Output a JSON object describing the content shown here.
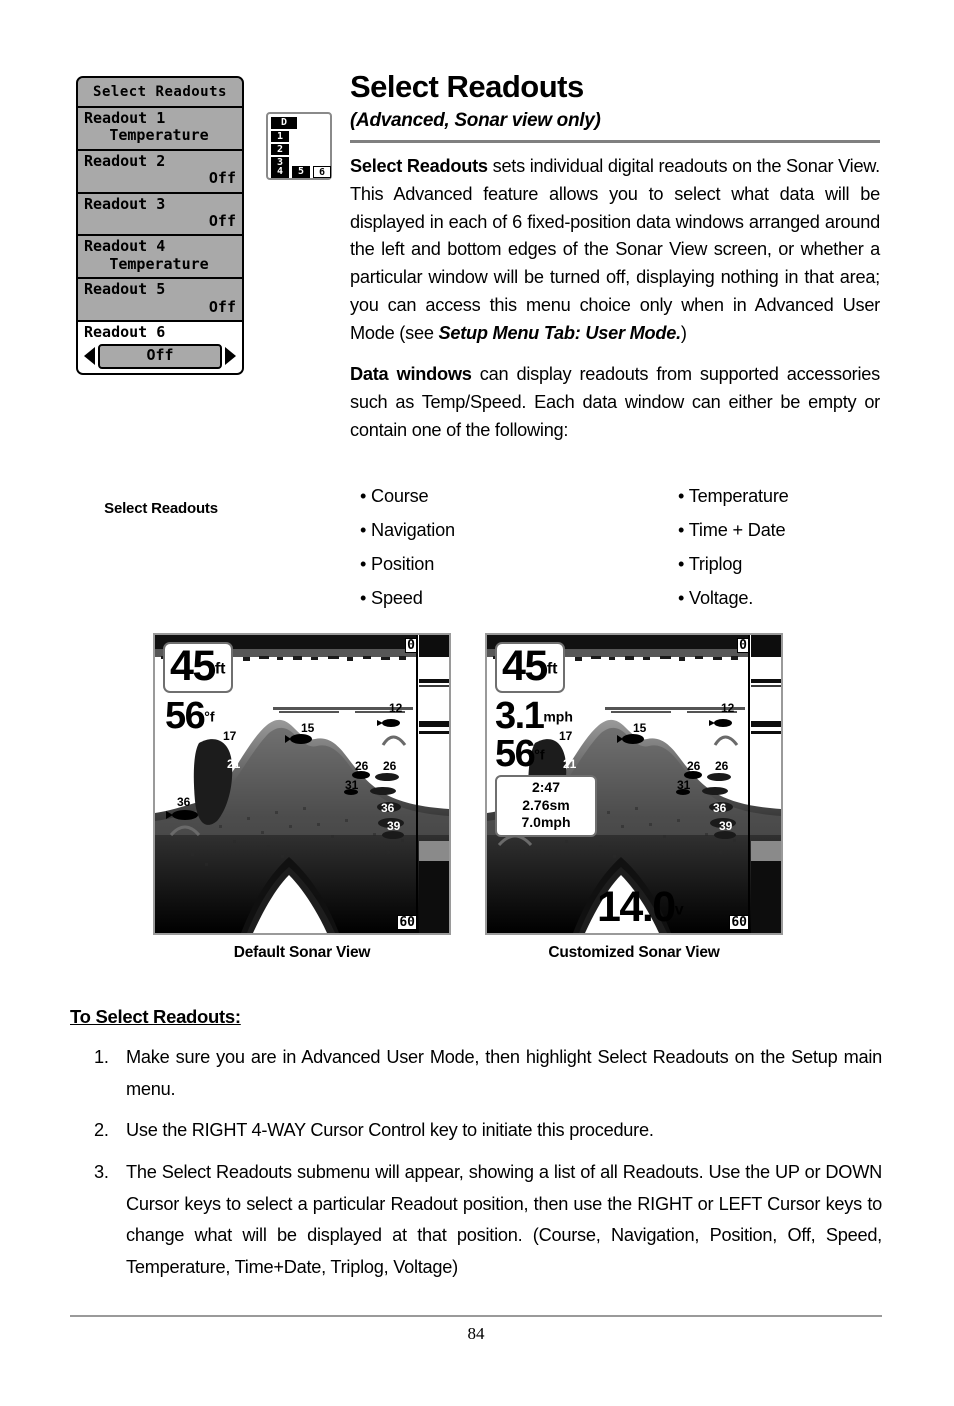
{
  "menu_screenshot": {
    "title": "Select Readouts",
    "rows": [
      {
        "label": "Readout 1",
        "value": "Temperature",
        "selected": false
      },
      {
        "label": "Readout 2",
        "value": "Off",
        "selected": false
      },
      {
        "label": "Readout 3",
        "value": "Off",
        "selected": false
      },
      {
        "label": "Readout 4",
        "value": "Temperature",
        "selected": false
      },
      {
        "label": "Readout 5",
        "value": "Off",
        "selected": false
      },
      {
        "label": "Readout 6",
        "value": "Off",
        "selected": true
      }
    ],
    "caption": "Select Readouts"
  },
  "layout_indicator": {
    "cells": [
      "D",
      "1",
      "2",
      "3",
      "4",
      "5",
      "6"
    ],
    "inverted_cell": "6"
  },
  "header": {
    "title": "Select Readouts",
    "subtitle": "(Advanced, Sonar view only)"
  },
  "body": {
    "para1_lead": "Select Readouts",
    "para1_rest": " sets individual digital readouts on the Sonar View. This Advanced feature allows you to select what data will be displayed in each of 6 fixed-position data windows arranged around the left and bottom edges of the Sonar View screen, or whether a particular window will be turned off, displaying nothing in that area; you can access this menu choice only when in Advanced User Mode (see ",
    "para1_italic": "Setup Menu Tab: User Mode.",
    "para1_tail": ")",
    "para2_lead": "Data windows",
    "para2_rest": " can display readouts from supported accessories such as Temp/Speed. Each data window can either be empty or contain one of the following:"
  },
  "bullets": {
    "column1": [
      "• Course",
      "• Navigation",
      "• Position",
      "• Speed"
    ],
    "column2": [
      "• Temperature",
      "• Time + Date",
      "• Triplog",
      "• Voltage."
    ]
  },
  "sonar_default": {
    "caption": "Default Sonar View",
    "depth": "45",
    "depth_unit": "ft",
    "temperature": "56",
    "temperature_unit": "°f",
    "scale_top": "0",
    "scale_bottom": "60",
    "fish_labels": [
      "15",
      "12",
      "17",
      "21",
      "36",
      "26",
      "26",
      "31",
      "36",
      "39"
    ]
  },
  "sonar_customized": {
    "caption": "Customized Sonar View",
    "depth": "45",
    "depth_unit": "ft",
    "speed": "3.1",
    "speed_unit": "mph",
    "temperature": "56",
    "temperature_unit": "°f",
    "triplog": [
      "2:47",
      "2.76sm",
      "7.0mph"
    ],
    "voltage": "14.0",
    "voltage_unit": "v",
    "scale_top": "0",
    "scale_bottom": "60",
    "fish_labels": [
      "15",
      "12",
      "17",
      "21",
      "26",
      "26",
      "31",
      "36",
      "39"
    ]
  },
  "procedure": {
    "title": "To Select Readouts:",
    "steps": [
      "Make sure you are in Advanced User Mode, then highlight Select Readouts on the Setup main menu.",
      "Use the RIGHT 4-WAY Cursor Control key to initiate this procedure.",
      "The Select Readouts submenu will appear, showing a list of all Readouts. Use the UP or DOWN Cursor keys to select a particular Readout position, then use the RIGHT or LEFT Cursor keys to change what will be displayed at that position. (Course, Navigation, Position, Off, Speed, Temperature, Time+Date, Triplog, Voltage)"
    ]
  },
  "footer": {
    "page_number": "84"
  },
  "colors": {
    "lcd_gray": "#a9a9a9",
    "rule_gray": "#808080",
    "frame_gray": "#9a9a9a"
  }
}
